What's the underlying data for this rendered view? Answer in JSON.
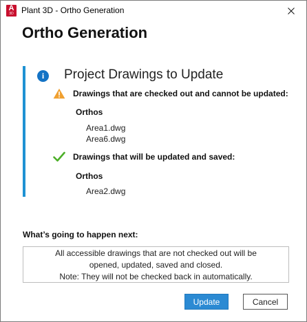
{
  "window": {
    "title": "Plant 3D - Ortho Generation",
    "app_icon_letter": "A",
    "app_icon_sub": "3D",
    "close_icon": "close-icon"
  },
  "heading": "Ortho Generation",
  "panel": {
    "icon": "info-icon",
    "title": "Project Drawings to Update",
    "checked_out": {
      "icon": "warning-icon",
      "title": "Drawings that are checked out and cannot be updated:",
      "group": "Orthos",
      "files": [
        "Area1.dwg",
        "Area6.dwg"
      ]
    },
    "to_update": {
      "icon": "check-icon",
      "title": "Drawings that will be updated and saved:",
      "group": "Orthos",
      "files": [
        "Area2.dwg"
      ]
    }
  },
  "next": {
    "label": "What’s going to happen next:",
    "lines": [
      "All accessible drawings that are not checked out will be",
      "opened, updated, saved and closed.",
      "Note: They will not be checked back in automatically."
    ]
  },
  "buttons": {
    "update": "Update",
    "cancel": "Cancel"
  },
  "colors": {
    "accent": "#1e92d3",
    "info": "#1473c5",
    "warning": "#f0a030",
    "success": "#4caf28",
    "primary_button": "#2b8ad3"
  }
}
